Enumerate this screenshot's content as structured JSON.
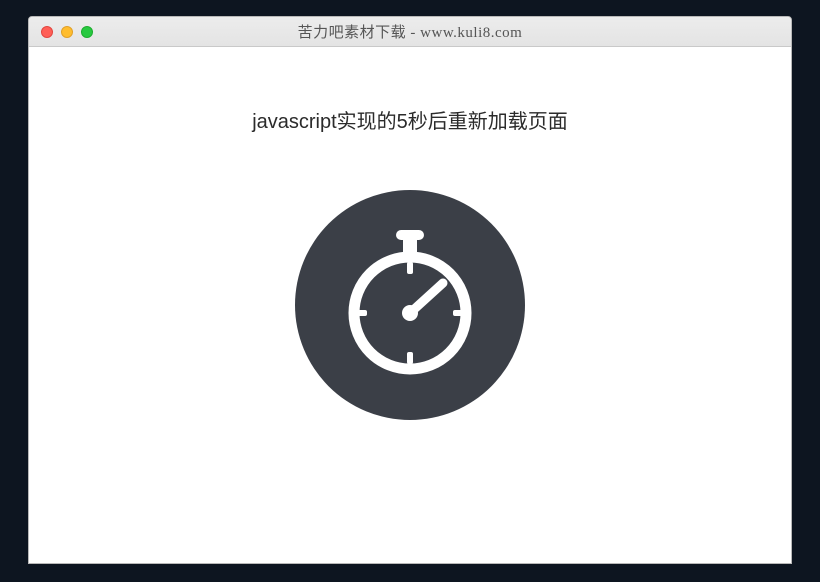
{
  "window": {
    "title": "苦力吧素材下载 - www.kuli8.com"
  },
  "page": {
    "heading": "javascript实现的5秒后重新加载页面"
  },
  "icon": {
    "name": "stopwatch-icon",
    "circle_bg": "#3b3f47",
    "stroke": "#ffffff"
  },
  "traffic_lights": {
    "red": "#ff5f57",
    "yellow": "#ffbd2e",
    "green": "#28c940"
  }
}
